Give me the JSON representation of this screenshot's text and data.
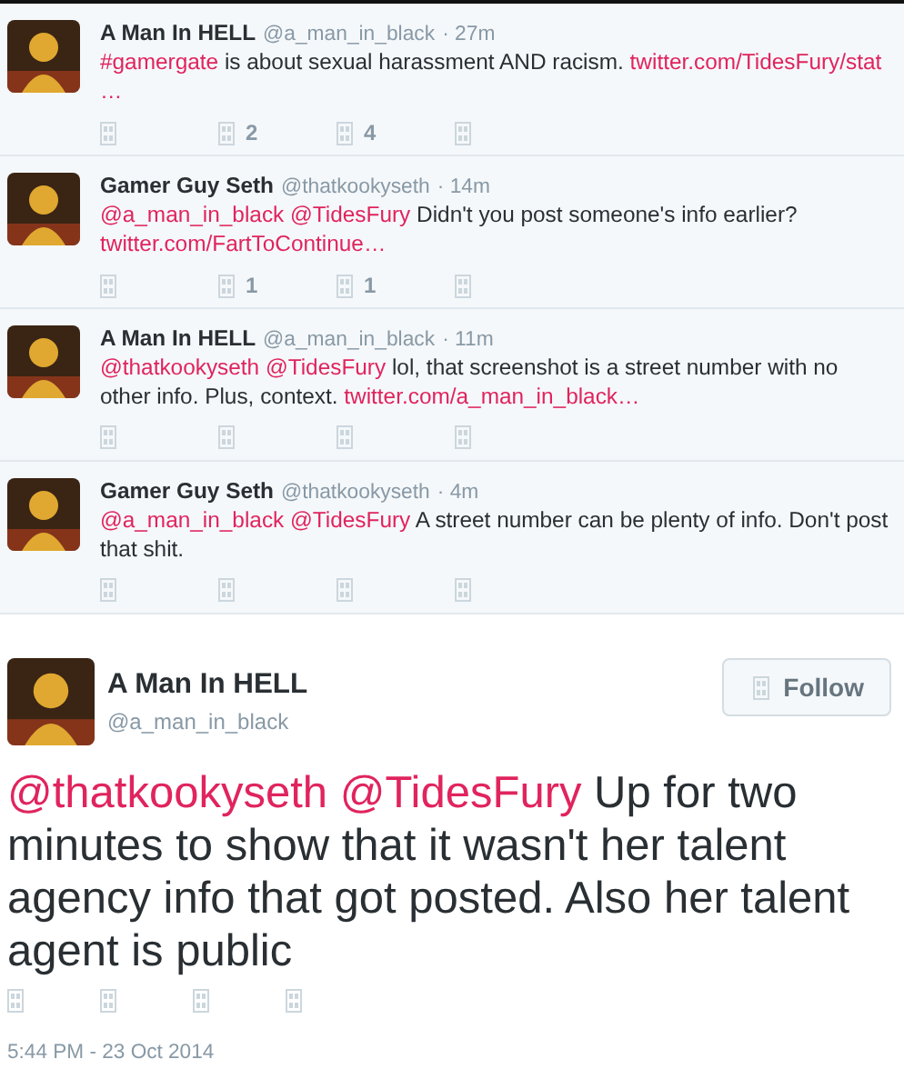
{
  "replies": [
    {
      "name": "A Man In HELL",
      "handle": "@a_man_in_black",
      "time": "· 27m",
      "body": [
        {
          "kind": "link",
          "text": "#gamergate"
        },
        {
          "kind": "plain",
          "text": "is about sexual harassment AND racism."
        },
        {
          "kind": "link",
          "text": "twitter.com/TidesFury/stat"
        },
        {
          "kind": "ellipsis",
          "text": "…"
        }
      ],
      "retweets": "2",
      "favorites": "4"
    },
    {
      "name": "Gamer Guy Seth",
      "handle": "@thatkookyseth",
      "time": "· 14m",
      "body": [
        {
          "kind": "link",
          "text": "@a_man_in_black"
        },
        {
          "kind": "link",
          "text": "@TidesFury"
        },
        {
          "kind": "plain",
          "text": "Didn't you post someone's info earlier?"
        },
        {
          "kind": "link",
          "text": "twitter.com/FartToContinue…"
        }
      ],
      "retweets": "1",
      "favorites": "1"
    },
    {
      "name": "A Man In HELL",
      "handle": "@a_man_in_black",
      "time": "· 11m",
      "body": [
        {
          "kind": "link",
          "text": "@thatkookyseth"
        },
        {
          "kind": "link",
          "text": "@TidesFury"
        },
        {
          "kind": "plain",
          "text": "lol, that screenshot is a street number with no other info. Plus, context."
        },
        {
          "kind": "link",
          "text": "twitter.com/a_man_in_black…"
        }
      ]
    },
    {
      "name": "Gamer Guy Seth",
      "handle": "@thatkookyseth",
      "time": "· 4m",
      "body": [
        {
          "kind": "link",
          "text": "@a_man_in_black"
        },
        {
          "kind": "link",
          "text": "@TidesFury"
        },
        {
          "kind": "plain",
          "text": "A street number can be plenty of info. Don't post that shit."
        }
      ]
    }
  ],
  "main": {
    "name": "A Man In HELL",
    "handle": "@a_man_in_black",
    "follow": "Follow",
    "body": [
      {
        "kind": "link",
        "text": "@thatkookyseth"
      },
      {
        "kind": "link",
        "text": "@TidesFury"
      },
      {
        "kind": "plain",
        "text": "Up for two minutes to show that it wasn't her talent agency info that got posted. Also her talent agent is public"
      }
    ],
    "date": "5:44 PM - 23 Oct 2014"
  }
}
